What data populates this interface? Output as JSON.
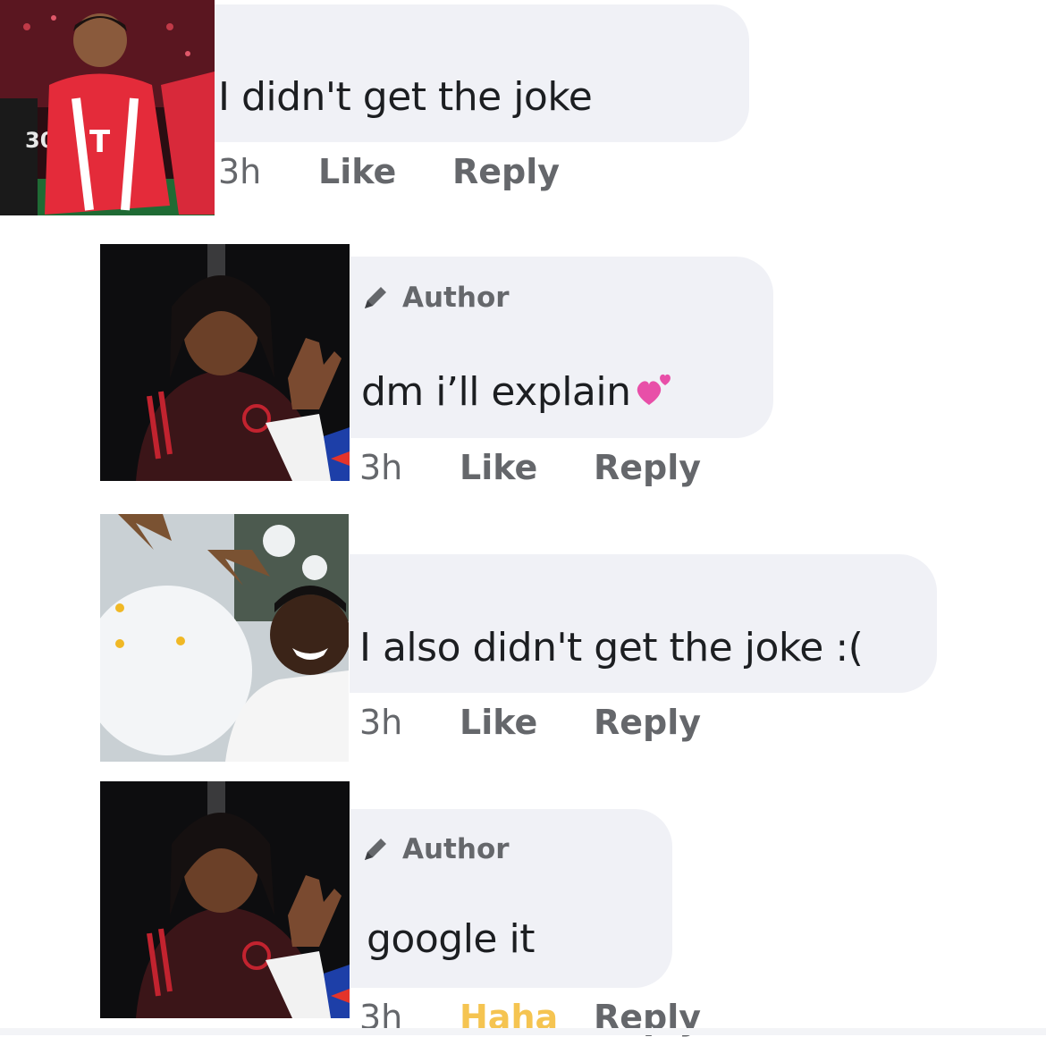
{
  "comments": [
    {
      "text": "I didn't get the joke",
      "time": "3h",
      "like_label": "Like",
      "reply_label": "Reply",
      "author_tag": ""
    },
    {
      "text": "dm i’ll explain",
      "emoji": "two-hearts-icon",
      "time": "3h",
      "like_label": "Like",
      "reply_label": "Reply",
      "author_tag": "Author"
    },
    {
      "text": "I also didn't get the joke :(",
      "time": "3h",
      "like_label": "Like",
      "reply_label": "Reply",
      "author_tag": ""
    },
    {
      "text": "google it",
      "time": "3h",
      "like_label": "Haha",
      "reply_label": "Reply",
      "author_tag": "Author"
    }
  ],
  "colors": {
    "bubble": "#f0f1f6",
    "meta_text": "#65676b",
    "haha_reaction": "#f5c451",
    "heart_pink": "#e84fa8"
  },
  "icons": [
    "pencil-icon",
    "two-hearts-icon"
  ]
}
